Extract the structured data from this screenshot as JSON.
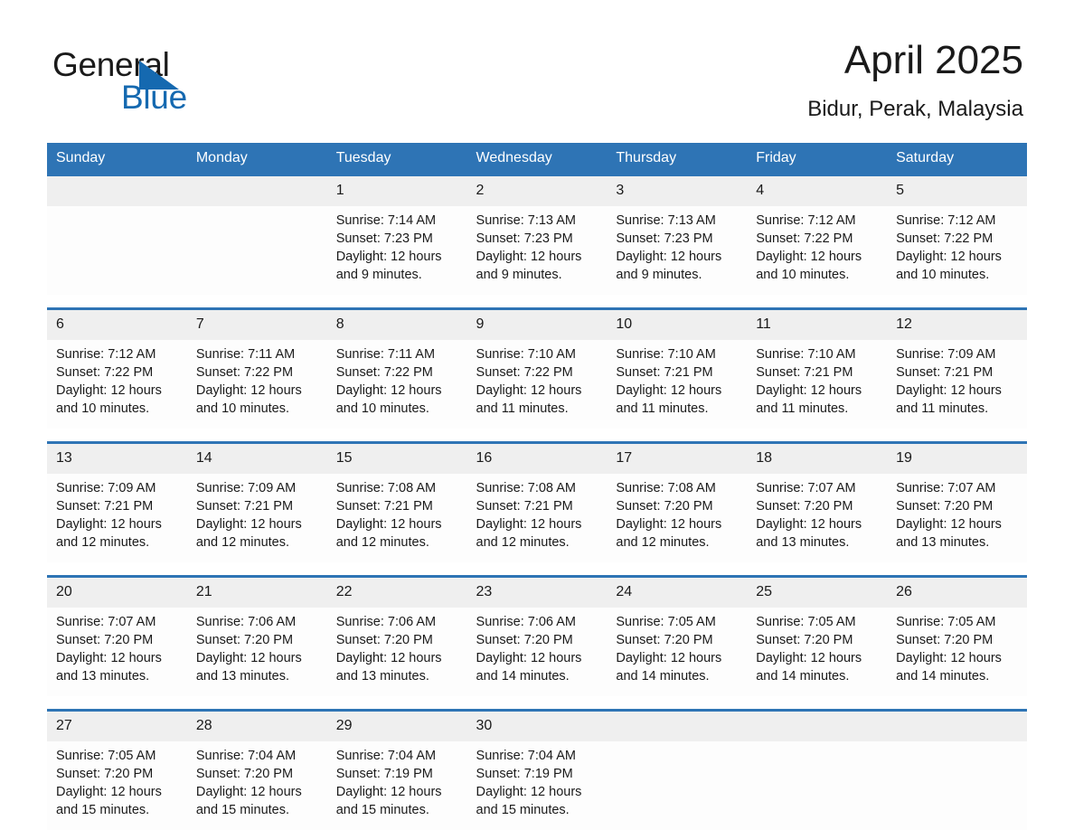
{
  "logo": {
    "word_black": "General",
    "word_blue": "Blue",
    "triangle": "triangle-icon",
    "brand_blue": "#1569b0"
  },
  "header": {
    "title": "April 2025",
    "location": "Bidur, Perak, Malaysia"
  },
  "colors": {
    "header_blue": "#2e74b5",
    "daynum_band": "#efefef",
    "cell_background": "#fdfdfd",
    "text": "#1a1a1a"
  },
  "weekday_headers": [
    "Sunday",
    "Monday",
    "Tuesday",
    "Wednesday",
    "Thursday",
    "Friday",
    "Saturday"
  ],
  "weeks": [
    {
      "days": [
        {
          "num": "",
          "sunrise": "",
          "sunset": "",
          "daylight": ""
        },
        {
          "num": "",
          "sunrise": "",
          "sunset": "",
          "daylight": ""
        },
        {
          "num": "1",
          "sunrise": "Sunrise: 7:14 AM",
          "sunset": "Sunset: 7:23 PM",
          "daylight": "Daylight: 12 hours and 9 minutes."
        },
        {
          "num": "2",
          "sunrise": "Sunrise: 7:13 AM",
          "sunset": "Sunset: 7:23 PM",
          "daylight": "Daylight: 12 hours and 9 minutes."
        },
        {
          "num": "3",
          "sunrise": "Sunrise: 7:13 AM",
          "sunset": "Sunset: 7:23 PM",
          "daylight": "Daylight: 12 hours and 9 minutes."
        },
        {
          "num": "4",
          "sunrise": "Sunrise: 7:12 AM",
          "sunset": "Sunset: 7:22 PM",
          "daylight": "Daylight: 12 hours and 10 minutes."
        },
        {
          "num": "5",
          "sunrise": "Sunrise: 7:12 AM",
          "sunset": "Sunset: 7:22 PM",
          "daylight": "Daylight: 12 hours and 10 minutes."
        }
      ]
    },
    {
      "days": [
        {
          "num": "6",
          "sunrise": "Sunrise: 7:12 AM",
          "sunset": "Sunset: 7:22 PM",
          "daylight": "Daylight: 12 hours and 10 minutes."
        },
        {
          "num": "7",
          "sunrise": "Sunrise: 7:11 AM",
          "sunset": "Sunset: 7:22 PM",
          "daylight": "Daylight: 12 hours and 10 minutes."
        },
        {
          "num": "8",
          "sunrise": "Sunrise: 7:11 AM",
          "sunset": "Sunset: 7:22 PM",
          "daylight": "Daylight: 12 hours and 10 minutes."
        },
        {
          "num": "9",
          "sunrise": "Sunrise: 7:10 AM",
          "sunset": "Sunset: 7:22 PM",
          "daylight": "Daylight: 12 hours and 11 minutes."
        },
        {
          "num": "10",
          "sunrise": "Sunrise: 7:10 AM",
          "sunset": "Sunset: 7:21 PM",
          "daylight": "Daylight: 12 hours and 11 minutes."
        },
        {
          "num": "11",
          "sunrise": "Sunrise: 7:10 AM",
          "sunset": "Sunset: 7:21 PM",
          "daylight": "Daylight: 12 hours and 11 minutes."
        },
        {
          "num": "12",
          "sunrise": "Sunrise: 7:09 AM",
          "sunset": "Sunset: 7:21 PM",
          "daylight": "Daylight: 12 hours and 11 minutes."
        }
      ]
    },
    {
      "days": [
        {
          "num": "13",
          "sunrise": "Sunrise: 7:09 AM",
          "sunset": "Sunset: 7:21 PM",
          "daylight": "Daylight: 12 hours and 12 minutes."
        },
        {
          "num": "14",
          "sunrise": "Sunrise: 7:09 AM",
          "sunset": "Sunset: 7:21 PM",
          "daylight": "Daylight: 12 hours and 12 minutes."
        },
        {
          "num": "15",
          "sunrise": "Sunrise: 7:08 AM",
          "sunset": "Sunset: 7:21 PM",
          "daylight": "Daylight: 12 hours and 12 minutes."
        },
        {
          "num": "16",
          "sunrise": "Sunrise: 7:08 AM",
          "sunset": "Sunset: 7:21 PM",
          "daylight": "Daylight: 12 hours and 12 minutes."
        },
        {
          "num": "17",
          "sunrise": "Sunrise: 7:08 AM",
          "sunset": "Sunset: 7:20 PM",
          "daylight": "Daylight: 12 hours and 12 minutes."
        },
        {
          "num": "18",
          "sunrise": "Sunrise: 7:07 AM",
          "sunset": "Sunset: 7:20 PM",
          "daylight": "Daylight: 12 hours and 13 minutes."
        },
        {
          "num": "19",
          "sunrise": "Sunrise: 7:07 AM",
          "sunset": "Sunset: 7:20 PM",
          "daylight": "Daylight: 12 hours and 13 minutes."
        }
      ]
    },
    {
      "days": [
        {
          "num": "20",
          "sunrise": "Sunrise: 7:07 AM",
          "sunset": "Sunset: 7:20 PM",
          "daylight": "Daylight: 12 hours and 13 minutes."
        },
        {
          "num": "21",
          "sunrise": "Sunrise: 7:06 AM",
          "sunset": "Sunset: 7:20 PM",
          "daylight": "Daylight: 12 hours and 13 minutes."
        },
        {
          "num": "22",
          "sunrise": "Sunrise: 7:06 AM",
          "sunset": "Sunset: 7:20 PM",
          "daylight": "Daylight: 12 hours and 13 minutes."
        },
        {
          "num": "23",
          "sunrise": "Sunrise: 7:06 AM",
          "sunset": "Sunset: 7:20 PM",
          "daylight": "Daylight: 12 hours and 14 minutes."
        },
        {
          "num": "24",
          "sunrise": "Sunrise: 7:05 AM",
          "sunset": "Sunset: 7:20 PM",
          "daylight": "Daylight: 12 hours and 14 minutes."
        },
        {
          "num": "25",
          "sunrise": "Sunrise: 7:05 AM",
          "sunset": "Sunset: 7:20 PM",
          "daylight": "Daylight: 12 hours and 14 minutes."
        },
        {
          "num": "26",
          "sunrise": "Sunrise: 7:05 AM",
          "sunset": "Sunset: 7:20 PM",
          "daylight": "Daylight: 12 hours and 14 minutes."
        }
      ]
    },
    {
      "days": [
        {
          "num": "27",
          "sunrise": "Sunrise: 7:05 AM",
          "sunset": "Sunset: 7:20 PM",
          "daylight": "Daylight: 12 hours and 15 minutes."
        },
        {
          "num": "28",
          "sunrise": "Sunrise: 7:04 AM",
          "sunset": "Sunset: 7:20 PM",
          "daylight": "Daylight: 12 hours and 15 minutes."
        },
        {
          "num": "29",
          "sunrise": "Sunrise: 7:04 AM",
          "sunset": "Sunset: 7:19 PM",
          "daylight": "Daylight: 12 hours and 15 minutes."
        },
        {
          "num": "30",
          "sunrise": "Sunrise: 7:04 AM",
          "sunset": "Sunset: 7:19 PM",
          "daylight": "Daylight: 12 hours and 15 minutes."
        },
        {
          "num": "",
          "sunrise": "",
          "sunset": "",
          "daylight": ""
        },
        {
          "num": "",
          "sunrise": "",
          "sunset": "",
          "daylight": ""
        },
        {
          "num": "",
          "sunrise": "",
          "sunset": "",
          "daylight": ""
        }
      ]
    }
  ]
}
